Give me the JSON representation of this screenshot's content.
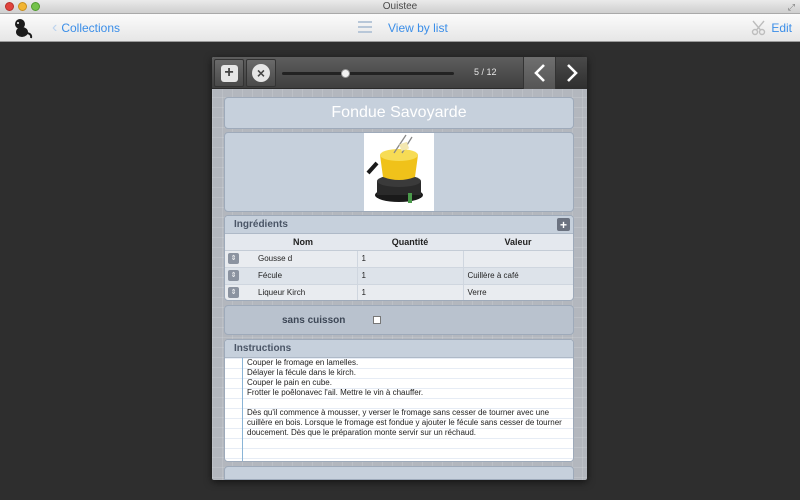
{
  "window": {
    "title": "Ouistee"
  },
  "toolbar": {
    "back_label": "Collections",
    "view_label": "View by list",
    "edit_label": "Edit"
  },
  "card": {
    "page_counter": "5 / 12",
    "progress": 0.36,
    "recipe": {
      "title": "Fondue Savoyarde"
    },
    "ingredients": {
      "header": "Ingrédients",
      "columns": [
        "Nom",
        "Quantité",
        "Valeur"
      ],
      "rows": [
        {
          "nom": "Gousse d",
          "quantite": "1",
          "valeur": ""
        },
        {
          "nom": "Fécule",
          "quantite": "1",
          "valeur": "Cuillère à café"
        },
        {
          "nom": "Liqueur Kirch",
          "quantite": "1",
          "valeur": "Verre"
        }
      ]
    },
    "cuisson": {
      "label": "sans cuisson",
      "checked": false
    },
    "instructions": {
      "header": "Instructions",
      "text": "Couper le fromage en lamelles.\nDélayer la fécule dans le kirch.\nCouper le pain en cube.\nFrotter le poêlonavec l'ail. Mettre le vin à chauffer.\n\nDès qu'il commence à mousser, y verser le fromage sans cesser de tourner avec une cuillère en bois. Lorsque le fromage est fondue y ajouter le fécule sans cesser de tourner doucement. Dès que le préparation monte servir sur un réchaud."
    }
  },
  "colors": {
    "accent": "#3b8ee8",
    "background": "#2e2e2e",
    "section": "#c6d0dc"
  },
  "icons": [
    "app-icon",
    "chevron-left-icon",
    "list-icon",
    "scissors-icon",
    "plus-icon",
    "close-icon",
    "chevron-right-icon",
    "reorder-handle-icon",
    "fullscreen-icon"
  ]
}
